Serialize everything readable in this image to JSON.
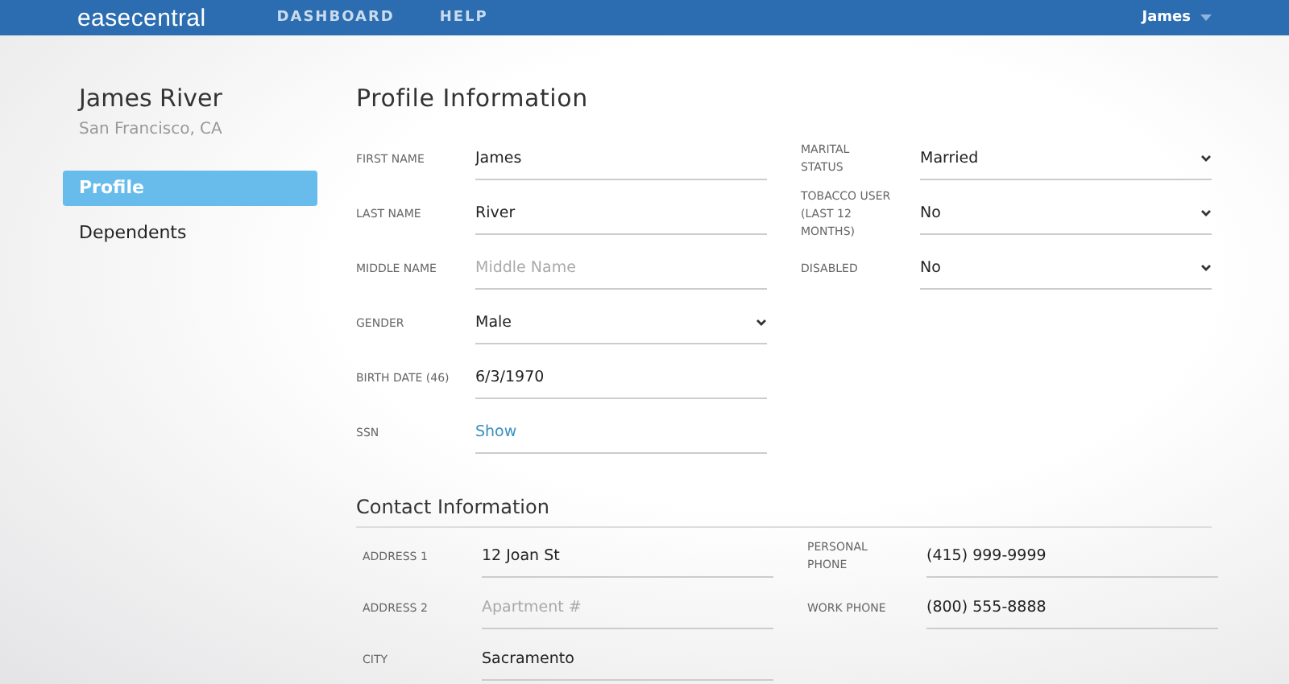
{
  "navbar": {
    "logo": {
      "light": "ease",
      "bold": "central"
    },
    "links": [
      "DASHBOARD",
      "HELP"
    ],
    "user": "James"
  },
  "sidebar": {
    "name": "James River",
    "location": "San Francisco, CA",
    "items": [
      {
        "label": "Profile",
        "selected": true
      },
      {
        "label": "Dependents",
        "selected": false
      }
    ]
  },
  "profile": {
    "title": "Profile Information",
    "left": [
      {
        "kind": "text",
        "label": "FIRST NAME",
        "value": "James"
      },
      {
        "kind": "text",
        "label": "LAST NAME",
        "value": "River"
      },
      {
        "kind": "text",
        "label": "MIDDLE NAME",
        "placeholder": "Middle Name"
      },
      {
        "kind": "select",
        "label": "GENDER",
        "value": "Male"
      },
      {
        "kind": "text",
        "label": "BIRTH DATE (46)",
        "value": "6/3/1970"
      },
      {
        "kind": "link",
        "label": "SSN",
        "value": "Show"
      }
    ],
    "right": [
      {
        "kind": "select",
        "label": "MARITAL STATUS",
        "value": "Married"
      },
      {
        "kind": "select",
        "label": "TOBACCO USER (LAST 12 MONTHS)",
        "value": "No"
      },
      {
        "kind": "select",
        "label": "DISABLED",
        "value": "No"
      }
    ]
  },
  "contact": {
    "title": "Contact Information",
    "left": [
      {
        "kind": "text",
        "label": "ADDRESS 1",
        "value": "12 Joan St"
      },
      {
        "kind": "text",
        "label": "ADDRESS 2",
        "placeholder": "Apartment #"
      },
      {
        "kind": "text",
        "label": "CITY",
        "value": "Sacramento"
      }
    ],
    "right": [
      {
        "kind": "text",
        "label": "PERSONAL PHONE",
        "value": "(415) 999-9999"
      },
      {
        "kind": "text",
        "label": "WORK PHONE",
        "value": "(800) 555-8888"
      }
    ]
  }
}
